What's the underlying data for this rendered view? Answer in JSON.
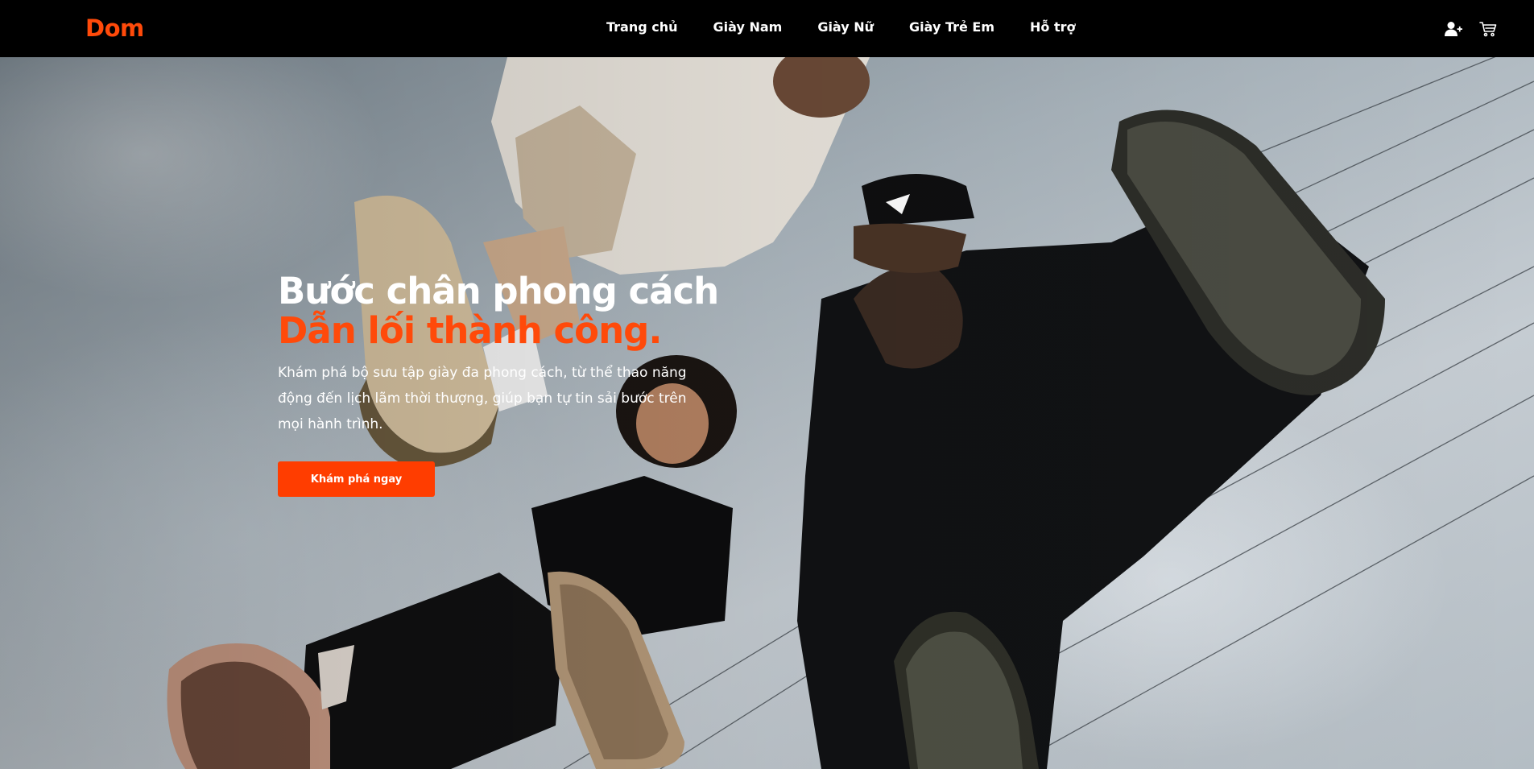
{
  "header": {
    "brand": "Dom",
    "nav": [
      {
        "label": "Trang chủ"
      },
      {
        "label": "Giày Nam"
      },
      {
        "label": "Giày Nữ"
      },
      {
        "label": "Giày Trẻ Em"
      },
      {
        "label": "Hỗ trợ"
      }
    ],
    "icons": {
      "account": "user-plus-icon",
      "cart": "shopping-cart-icon"
    }
  },
  "hero": {
    "title_line1": "Bước chân phong cách",
    "title_line2": "Dẫn lối thành công.",
    "description": "Khám phá bộ sưu tập giày đa phong cách, từ thể thao năng động đến lịch lãm thời thượng, giúp bạn tự tin sải bước trên mọi hành trình.",
    "cta_label": "Khám phá ngay",
    "image": "hero-photo-sneakers-low-angle"
  },
  "colors": {
    "accent": "#ff4a0a",
    "nav_background": "#000000",
    "text_light": "#ffffff"
  }
}
